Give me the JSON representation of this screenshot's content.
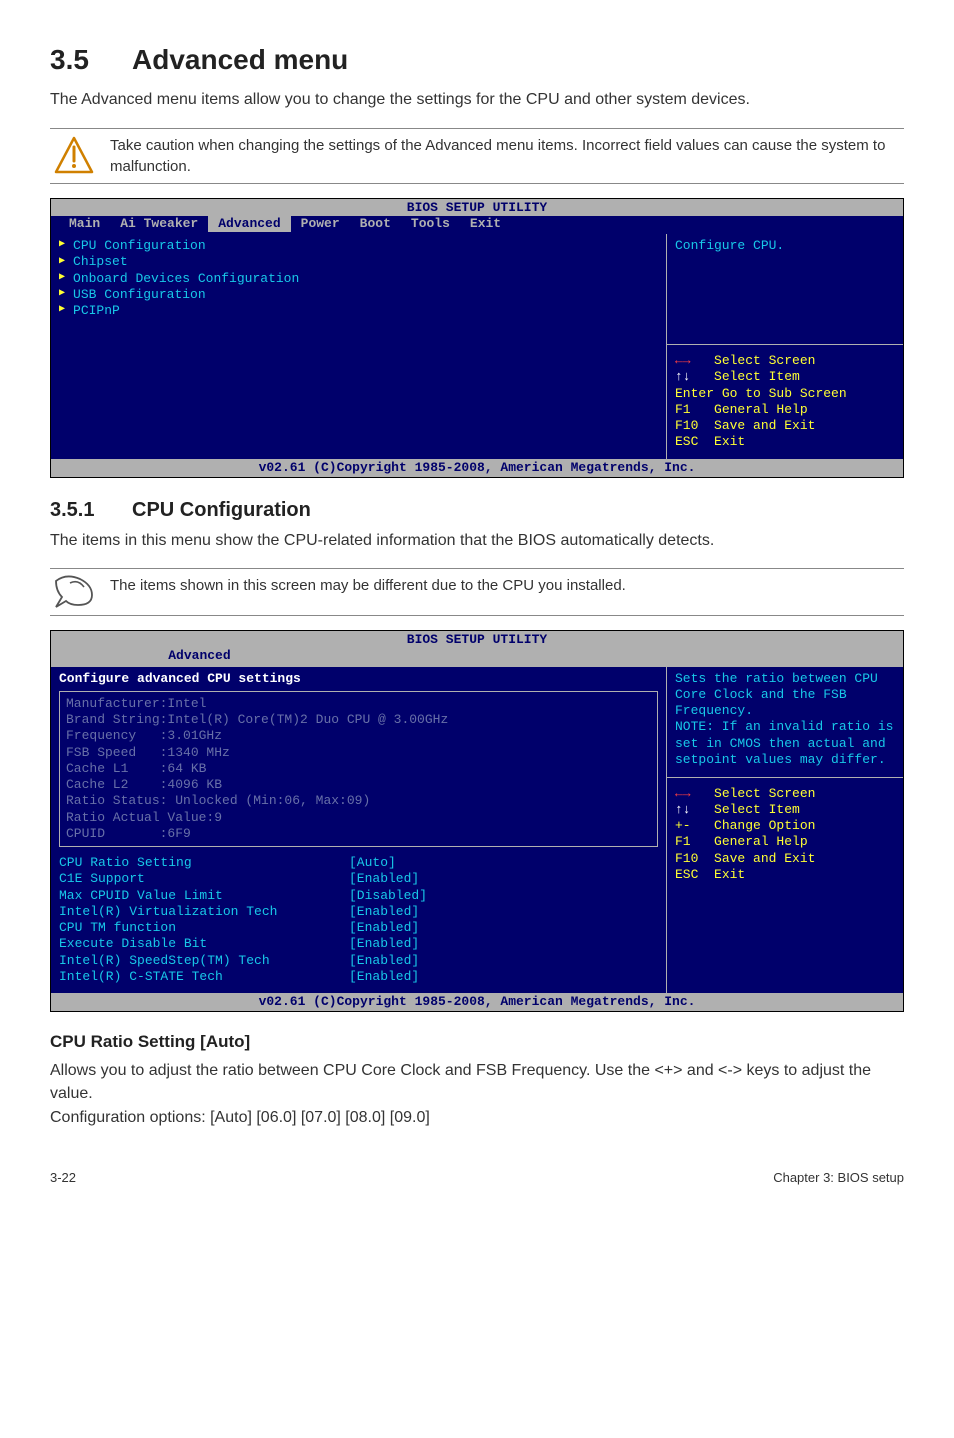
{
  "h1_num": "3.5",
  "h1_txt": "Advanced menu",
  "p_intro": "The Advanced menu items allow you to change the settings for the CPU and other system devices.",
  "warn_note": "Take caution when changing the settings of the Advanced menu items. Incorrect field values can cause the system to malfunction.",
  "bios1": {
    "title": "BIOS SETUP UTILITY",
    "menu": [
      "Main",
      "Ai Tweaker",
      "Advanced",
      "Power",
      "Boot",
      "Tools",
      "Exit"
    ],
    "menu_sel": "Advanced",
    "left_items": [
      "CPU Configuration",
      "Chipset",
      "Onboard Devices Configuration",
      "USB Configuration",
      "PCIPnP"
    ],
    "help": "Configure CPU.",
    "keys": [
      {
        "k": "←→",
        "t": "Select Screen"
      },
      {
        "k": "↑↓",
        "t": "Select Item"
      },
      {
        "k": "Enter",
        "t": "Go to Sub Screen"
      },
      {
        "k": "F1",
        "t": "General Help"
      },
      {
        "k": "F10",
        "t": "Save and Exit"
      },
      {
        "k": "ESC",
        "t": "Exit"
      }
    ],
    "foot": "v02.61 (C)Copyright 1985-2008, American Megatrends, Inc."
  },
  "h2_num": "3.5.1",
  "h2_txt": "CPU Configuration",
  "p_351": "The items in this menu show the CPU-related information that the BIOS automatically detects.",
  "tip_note": "The items shown in this screen may be different due to the CPU you installed.",
  "bios2": {
    "title": "BIOS SETUP UTILITY",
    "menu_sel": "Advanced",
    "heading": "Configure advanced CPU settings",
    "info": [
      "Manufacturer:Intel",
      "Brand String:Intel(R) Core(TM)2 Duo CPU @ 3.00GHz",
      "Frequency   :3.01GHz",
      "FSB Speed   :1340 MHz",
      "Cache L1    :64 KB",
      "Cache L2    :4096 KB",
      "Ratio Status: Unlocked (Min:06, Max:09)",
      "Ratio Actual Value:9",
      "CPUID       :6F9"
    ],
    "settings": [
      {
        "k": "CPU Ratio Setting",
        "v": "[Auto]"
      },
      {
        "k": "C1E Support",
        "v": "[Enabled]"
      },
      {
        "k": "Max CPUID Value Limit",
        "v": "[Disabled]"
      },
      {
        "k": "Intel(R) Virtualization Tech",
        "v": "[Enabled]"
      },
      {
        "k": "CPU TM function",
        "v": "[Enabled]"
      },
      {
        "k": "Execute Disable Bit",
        "v": "[Enabled]"
      },
      {
        "k": "Intel(R) SpeedStep(TM) Tech",
        "v": "[Enabled]"
      },
      {
        "k": "Intel(R) C-STATE Tech",
        "v": "[Enabled]"
      }
    ],
    "help": "Sets the ratio between CPU Core Clock and the FSB Frequency.\nNOTE: If an invalid ratio is set in CMOS then actual and setpoint values may differ.",
    "keys": [
      {
        "k": "←→",
        "t": "Select Screen"
      },
      {
        "k": "↑↓",
        "t": "Select Item"
      },
      {
        "k": "+-",
        "t": "Change Option"
      },
      {
        "k": "F1",
        "t": "General Help"
      },
      {
        "k": "F10",
        "t": "Save and Exit"
      },
      {
        "k": "ESC",
        "t": "Exit"
      }
    ],
    "foot": "v02.61 (C)Copyright 1985-2008, American Megatrends, Inc."
  },
  "h3_ratio": "CPU Ratio Setting [Auto]",
  "p_ratio1": "Allows you to adjust the ratio between CPU Core Clock and FSB Frequency. Use the <+> and <-> keys to adjust the value.",
  "p_ratio2": "Configuration options: [Auto] [06.0] [07.0] [08.0] [09.0]",
  "footer_left": "3-22",
  "footer_right": "Chapter 3: BIOS setup"
}
